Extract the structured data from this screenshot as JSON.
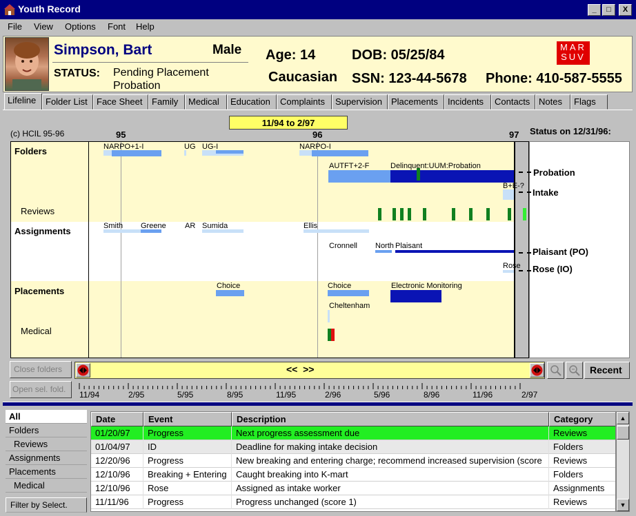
{
  "window": {
    "title": "Youth Record",
    "minimize": "_",
    "maximize": "□",
    "close": "X"
  },
  "menu": [
    "File",
    "View",
    "Options",
    "Font",
    "Help"
  ],
  "person": {
    "name": "Simpson, Bart",
    "sex": "Male",
    "age": "Age: 14",
    "race": "Caucasian",
    "dob": "DOB: 05/25/84",
    "ssn": "SSN: 123-44-5678",
    "phone": "Phone: 410-587-5555",
    "status_label": "STATUS:",
    "status_line1": "Pending Placement",
    "status_line2": "Probation",
    "logo": "MAR\nSUV"
  },
  "tabs": [
    "Lifeline",
    "Folder List",
    "Face Sheet",
    "Family",
    "Medical",
    "Education",
    "Complaints",
    "Supervision",
    "Placements",
    "Incidents",
    "Contacts",
    "Notes",
    "Flags"
  ],
  "timeline": {
    "range": "11/94 to 2/97",
    "copyright": "(c) HCIL 95-96",
    "years": [
      "95",
      "96",
      "97"
    ],
    "status_header": "Status on 12/31/96:",
    "rows": {
      "folders": "Folders",
      "reviews": "Reviews",
      "assignments": "Assignments",
      "placements": "Placements",
      "medical": "Medical"
    },
    "labels": {
      "narpo1": "NARPO+1-I",
      "ug": "UG",
      "ugi": "UG-I",
      "narpoi": "NARPO-I",
      "autft": "AUTFT+2-F",
      "delinquent": "Delinquent:UUM:Probation",
      "bee": "B+E-?",
      "smith": "Smith",
      "greene": "Greene",
      "ar": "AR",
      "sumida": "Sumida",
      "ellis": "Ellis",
      "cronnell": "Cronnell",
      "north": "North",
      "plaisant": "Plaisant",
      "rose": "Rose",
      "choice1": "Choice",
      "choice2": "Choice",
      "em": "Electronic Monitoring",
      "cheltenham": "Cheltenham"
    },
    "status_items": [
      "Probation",
      "Intake",
      "Plaisant (PO)",
      "Rose (IO)"
    ]
  },
  "nav": {
    "close_folders": "Close folders",
    "open_sel": "Open sel. fold.",
    "scroll": "<<  >>",
    "recent": "Recent",
    "ticks": [
      "11/94",
      "2/95",
      "5/95",
      "8/95",
      "11/95",
      "2/96",
      "5/96",
      "8/96",
      "11/96",
      "2/97"
    ]
  },
  "filters": [
    "All",
    "Folders",
    "Reviews",
    "Assignments",
    "Placements",
    "Medical",
    "Filter by Select."
  ],
  "table": {
    "headers": [
      "Date",
      "Event",
      "Description",
      "Category"
    ],
    "rows": [
      [
        "01/20/97",
        "Progress",
        "Next progress assessment due",
        "Reviews"
      ],
      [
        "01/04/97",
        "ID",
        "Deadline for making intake decision",
        "Folders"
      ],
      [
        "12/20/96",
        "Progress",
        "New breaking and entering charge; recommend increased supervision (score",
        "Reviews"
      ],
      [
        "12/10/96",
        "Breaking + Entering",
        "Caught breaking into K-mart",
        "Folders"
      ],
      [
        "12/10/96",
        "Rose",
        "Assigned as intake worker",
        "Assignments"
      ],
      [
        "11/11/96",
        "Progress",
        "Progress unchanged (score 1)",
        "Reviews"
      ]
    ]
  },
  "colors": {
    "highlight_row": "#22ee22",
    "accent": "#000080"
  }
}
